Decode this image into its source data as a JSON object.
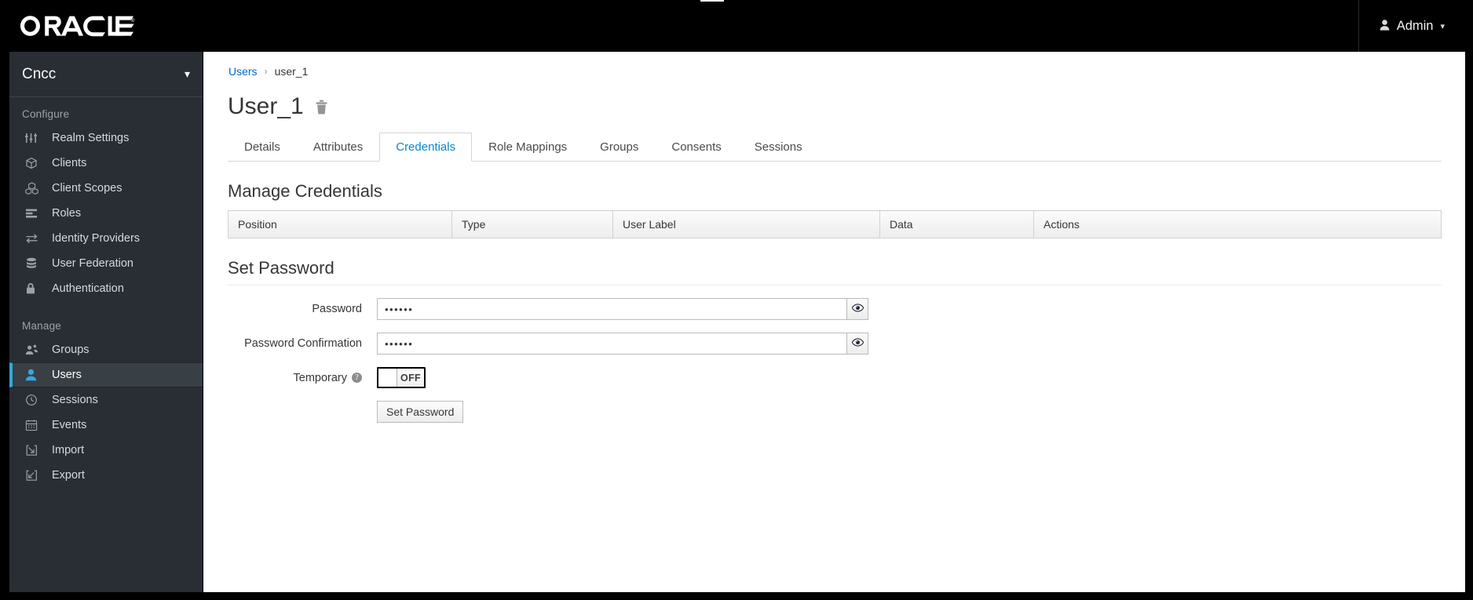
{
  "masthead": {
    "brand": "ORACLE",
    "brand_registered": "®",
    "user_label": "Admin",
    "user_icon": "user-icon",
    "caret_icon": "chevron-down-icon"
  },
  "sidebar": {
    "realm": {
      "name": "Cncc",
      "caret_icon": "chevron-down-icon"
    },
    "sections": [
      {
        "title": "Configure",
        "items": [
          {
            "label": "Realm Settings",
            "icon": "sliders-icon",
            "active": false
          },
          {
            "label": "Clients",
            "icon": "cube-icon",
            "active": false
          },
          {
            "label": "Client Scopes",
            "icon": "cubes-icon",
            "active": false
          },
          {
            "label": "Roles",
            "icon": "list-rows-icon",
            "active": false
          },
          {
            "label": "Identity Providers",
            "icon": "exchange-arrows-icon",
            "active": false
          },
          {
            "label": "User Federation",
            "icon": "database-icon",
            "active": false
          },
          {
            "label": "Authentication",
            "icon": "lock-icon",
            "active": false
          }
        ]
      },
      {
        "title": "Manage",
        "items": [
          {
            "label": "Groups",
            "icon": "users-group-icon",
            "active": false
          },
          {
            "label": "Users",
            "icon": "user-icon",
            "active": true
          },
          {
            "label": "Sessions",
            "icon": "clock-icon",
            "active": false
          },
          {
            "label": "Events",
            "icon": "calendar-icon",
            "active": false
          },
          {
            "label": "Import",
            "icon": "import-arrow-icon",
            "active": false
          },
          {
            "label": "Export",
            "icon": "export-arrow-icon",
            "active": false
          }
        ]
      }
    ]
  },
  "breadcrumb": {
    "root": "Users",
    "separator": "›",
    "current": "user_1"
  },
  "page": {
    "title": "User_1",
    "delete_icon": "trash-icon"
  },
  "tabs": [
    {
      "label": "Details",
      "active": false
    },
    {
      "label": "Attributes",
      "active": false
    },
    {
      "label": "Credentials",
      "active": true
    },
    {
      "label": "Role Mappings",
      "active": false
    },
    {
      "label": "Groups",
      "active": false
    },
    {
      "label": "Consents",
      "active": false
    },
    {
      "label": "Sessions",
      "active": false
    }
  ],
  "manage_credentials": {
    "heading": "Manage Credentials",
    "columns": [
      "Position",
      "Type",
      "User Label",
      "Data",
      "Actions"
    ],
    "rows": []
  },
  "set_password": {
    "heading": "Set Password",
    "password": {
      "label": "Password",
      "value": "••••••",
      "placeholder": "",
      "reveal_icon": "eye-icon"
    },
    "password_confirmation": {
      "label": "Password Confirmation",
      "value": "••••••",
      "placeholder": "",
      "reveal_icon": "eye-icon"
    },
    "temporary": {
      "label": "Temporary",
      "help_icon": "question-circle-icon",
      "help_glyph": "?",
      "state": "OFF"
    },
    "submit_label": "Set Password"
  },
  "colors": {
    "masthead_bg": "#000000",
    "sidebar_bg": "#292e34",
    "sidebar_active_bg": "#383f45",
    "accent_blue": "#0088ce",
    "link_blue": "#0066cc",
    "active_marker": "#39a5dc",
    "text_dark": "#363636"
  }
}
